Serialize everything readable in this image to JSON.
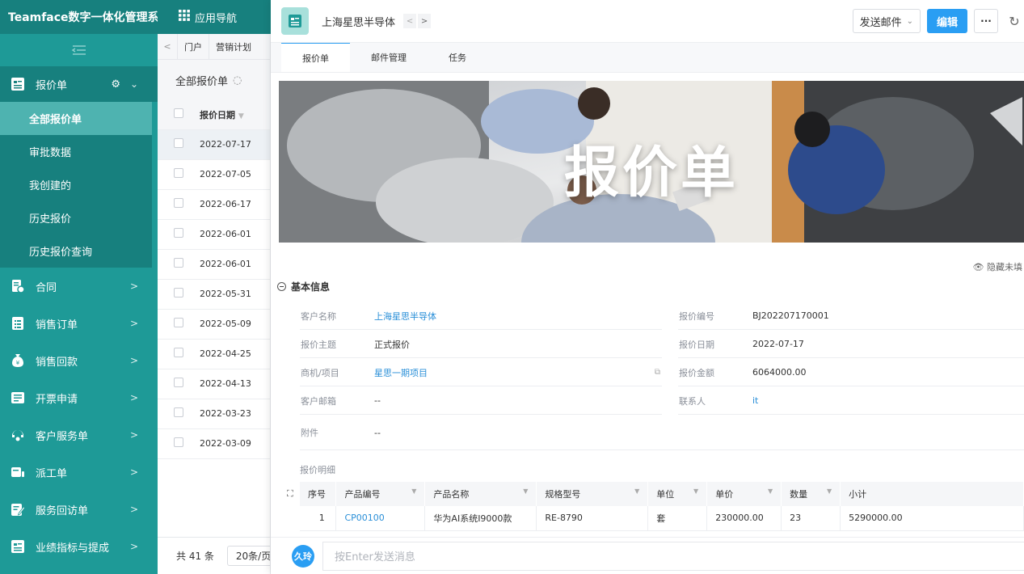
{
  "app": {
    "title": "Teamface数字一体化管理系统",
    "nav_label": "应用导航"
  },
  "sidebar": {
    "open_module": {
      "label": "报价单",
      "icon": "quote-icon"
    },
    "submenu": [
      {
        "label": "全部报价单",
        "active": true
      },
      {
        "label": "审批数据"
      },
      {
        "label": "我创建的"
      },
      {
        "label": "历史报价"
      },
      {
        "label": "历史报价查询"
      }
    ],
    "items": [
      {
        "label": "合同",
        "icon": "contract-icon"
      },
      {
        "label": "销售订单",
        "icon": "order-icon"
      },
      {
        "label": "销售回款",
        "icon": "money-bag-icon"
      },
      {
        "label": "开票申请",
        "icon": "invoice-icon"
      },
      {
        "label": "客户服务单",
        "icon": "service-icon"
      },
      {
        "label": "派工单",
        "icon": "dispatch-icon"
      },
      {
        "label": "服务回访单",
        "icon": "revisit-icon"
      },
      {
        "label": "业绩指标与提成",
        "icon": "performance-icon"
      }
    ]
  },
  "list": {
    "tabs": [
      "门户",
      "营销计划"
    ],
    "title": "全部报价单",
    "column": "报价日期",
    "rows": [
      "2022-07-17",
      "2022-07-05",
      "2022-06-17",
      "2022-06-01",
      "2022-06-01",
      "2022-05-31",
      "2022-05-09",
      "2022-04-25",
      "2022-04-13",
      "2022-03-23",
      "2022-03-09"
    ],
    "total": "共 41 条",
    "page_size": "20条/页"
  },
  "detail": {
    "title": "上海星思半导体",
    "send_mail": "发送邮件",
    "edit": "编辑",
    "tabs": [
      "报价单",
      "邮件管理",
      "任务"
    ],
    "banner_text": "报价单",
    "hide_empty": "隐藏未填",
    "section_title": "基本信息",
    "fields": {
      "customer_name": {
        "label": "客户名称",
        "value": "上海星思半导体"
      },
      "quote_no": {
        "label": "报价编号",
        "value": "BJ202207170001"
      },
      "subject": {
        "label": "报价主题",
        "value": "正式报价"
      },
      "quote_date": {
        "label": "报价日期",
        "value": "2022-07-17"
      },
      "project": {
        "label": "商机/项目",
        "value": "星思一期项目"
      },
      "amount": {
        "label": "报价金额",
        "value": "6064000.00"
      },
      "email": {
        "label": "客户邮箱",
        "value": "--"
      },
      "contact": {
        "label": "联系人",
        "value": "it"
      },
      "attachment": {
        "label": "附件",
        "value": "--"
      }
    },
    "detail_label": "报价明细",
    "table_headers": [
      "序号",
      "产品编号",
      "产品名称",
      "规格型号",
      "单位",
      "单价",
      "数量",
      "小计"
    ],
    "table_rows": [
      [
        "1",
        "CP00100",
        "华为AI系统I9000款",
        "RE-8790",
        "套",
        "230000.00",
        "23",
        "5290000.00"
      ]
    ],
    "message_avatar": "久玲",
    "message_placeholder": "按Enter发送消息"
  },
  "colors": {
    "sidebar": "#1e9a97",
    "sidebar_dark": "#17807e",
    "accent": "#2a9ef3"
  }
}
